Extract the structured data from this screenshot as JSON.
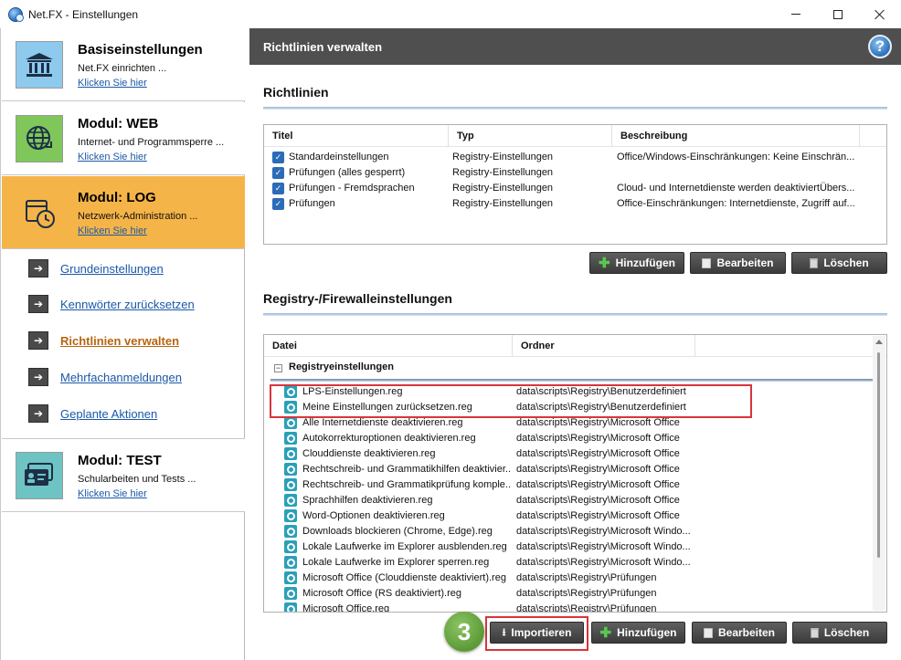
{
  "window": {
    "title": "Net.FX - Einstellungen"
  },
  "sidebar": {
    "modules": [
      {
        "title": "Basiseinstellungen",
        "desc": "Net.FX einrichten ...",
        "link": "Klicken Sie hier",
        "icon": "bank-icon"
      },
      {
        "title": "Modul: WEB",
        "desc": "Internet- und Programmsperre ...",
        "link": "Klicken Sie hier",
        "icon": "globe-icon"
      },
      {
        "title": "Modul: LOG",
        "desc": "Netzwerk-Administration ...",
        "link": "Klicken Sie hier",
        "icon": "calendar-clock-icon"
      },
      {
        "title": "Modul: TEST",
        "desc": "Schularbeiten und Tests ...",
        "link": "Klicken Sie hier",
        "icon": "id-card-icon"
      }
    ],
    "items": [
      {
        "label": "Grundeinstellungen"
      },
      {
        "label": "Kennwörter zurücksetzen"
      },
      {
        "label": "Richtlinien verwalten"
      },
      {
        "label": "Mehrfachanmeldungen"
      },
      {
        "label": "Geplante Aktionen"
      }
    ],
    "active_item": "Richtlinien verwalten"
  },
  "main": {
    "header": "Richtlinien verwalten",
    "policies": {
      "title": "Richtlinien",
      "columns": [
        "Titel",
        "Typ",
        "Beschreibung"
      ],
      "rows": [
        {
          "title": "Standardeinstellungen",
          "type": "Registry-Einstellungen",
          "desc": "Office/Windows-Einschränkungen: Keine Einschrän..."
        },
        {
          "title": "Prüfungen (alles gesperrt)",
          "type": "Registry-Einstellungen",
          "desc": ""
        },
        {
          "title": "Prüfungen - Fremdsprachen",
          "type": "Registry-Einstellungen",
          "desc": "Cloud- und Internetdienste werden deaktiviertÜbers..."
        },
        {
          "title": "Prüfungen",
          "type": "Registry-Einstellungen",
          "desc": "Office-Einschränkungen: Internetdienste, Zugriff auf..."
        }
      ],
      "buttons": {
        "add": "Hinzufügen",
        "edit": "Bearbeiten",
        "delete": "Löschen"
      }
    },
    "registry": {
      "title": "Registry-/Firewalleinstellungen",
      "columns": [
        "Datei",
        "Ordner"
      ],
      "group": "Registryeinstellungen",
      "rows": [
        {
          "file": "LPS-Einstellungen.reg",
          "folder": "data\\scripts\\Registry\\Benutzerdefiniert"
        },
        {
          "file": "Meine Einstellungen zurücksetzen.reg",
          "folder": "data\\scripts\\Registry\\Benutzerdefiniert"
        },
        {
          "file": "Alle Internetdienste deaktivieren.reg",
          "folder": "data\\scripts\\Registry\\Microsoft Office"
        },
        {
          "file": "Autokorrekturoptionen deaktivieren.reg",
          "folder": "data\\scripts\\Registry\\Microsoft Office"
        },
        {
          "file": "Clouddienste deaktivieren.reg",
          "folder": "data\\scripts\\Registry\\Microsoft Office"
        },
        {
          "file": "Rechtschreib- und Grammatikhilfen deaktivier...",
          "folder": "data\\scripts\\Registry\\Microsoft Office"
        },
        {
          "file": "Rechtschreib- und Grammatikprüfung komple...",
          "folder": "data\\scripts\\Registry\\Microsoft Office"
        },
        {
          "file": "Sprachhilfen deaktivieren.reg",
          "folder": "data\\scripts\\Registry\\Microsoft Office"
        },
        {
          "file": "Word-Optionen deaktivieren.reg",
          "folder": "data\\scripts\\Registry\\Microsoft Office"
        },
        {
          "file": "Downloads blockieren (Chrome, Edge).reg",
          "folder": "data\\scripts\\Registry\\Microsoft Windo..."
        },
        {
          "file": "Lokale Laufwerke im Explorer ausblenden.reg",
          "folder": "data\\scripts\\Registry\\Microsoft Windo..."
        },
        {
          "file": "Lokale Laufwerke im Explorer sperren.reg",
          "folder": "data\\scripts\\Registry\\Microsoft Windo..."
        },
        {
          "file": "Microsoft Office (Clouddienste deaktiviert).reg",
          "folder": "data\\scripts\\Registry\\Prüfungen"
        },
        {
          "file": "Microsoft Office (RS deaktiviert).reg",
          "folder": "data\\scripts\\Registry\\Prüfungen"
        },
        {
          "file": "Microsoft Office.reg",
          "folder": "data\\scripts\\Registry\\Prüfungen"
        }
      ],
      "buttons": {
        "import": "Importieren",
        "add": "Hinzufügen",
        "edit": "Bearbeiten",
        "delete": "Löschen"
      }
    },
    "step_badge": "3"
  },
  "colors": {
    "active_module": "#f5b448",
    "header_bar": "#4f4f4f",
    "link": "#1a58a8",
    "highlight": "#d9353a",
    "badge": "#5c9a36"
  }
}
